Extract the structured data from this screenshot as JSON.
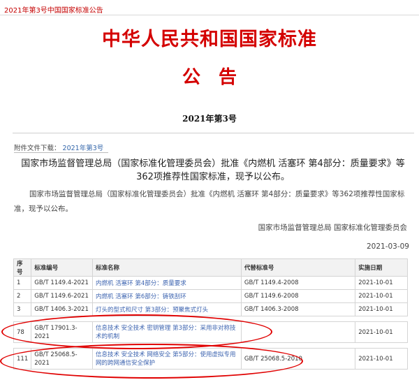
{
  "topbar": {
    "breadcrumb": "2021年第3号中国国家标准公告"
  },
  "header": {
    "title": "中华人民共和国国家标准",
    "subtitle": "公告",
    "issue": "2021年第3号"
  },
  "attachment": {
    "label": "附件文件下载：",
    "link": "2021年第3号"
  },
  "notice": {
    "headline": "国家市场监督管理总局（国家标准化管理委员会）批准《内燃机 活塞环 第4部分：质量要求》等362项推荐性国家标准，现予以公布。",
    "body": "国家市场监督管理总局（国家标准化管理委员会）批准《内燃机 活塞环 第4部分：质量要求》等362项推荐性国家标准，现予以公布。",
    "signer": "国家市场监督管理总局 国家标准化管理委员会",
    "date": "2021-03-09"
  },
  "table": {
    "headers": {
      "no": "序号",
      "code": "标准编号",
      "name": "标准名称",
      "replaced": "代替标准号",
      "date": "实施日期"
    },
    "rows": [
      {
        "no": "1",
        "code": "GB/T 1149.4-2021",
        "name": "内燃机 活塞环 第4部分：质量要求",
        "replaced": "GB/T 1149.4-2008",
        "date": "2021-10-01"
      },
      {
        "no": "2",
        "code": "GB/T 1149.6-2021",
        "name": "内燃机 活塞环 第6部分：铸铁刮环",
        "replaced": "GB/T 1149.6-2008",
        "date": "2021-10-01"
      },
      {
        "no": "3",
        "code": "GB/T 1406.3-2021",
        "name": "灯头的型式和尺寸 第3部分：预聚焦式灯头",
        "replaced": "GB/T 1406.3-2008",
        "date": "2021-10-01"
      },
      {
        "no": "78",
        "code": "GB/T 17901.3-2021",
        "name": "信息技术 安全技术 密钥管理 第3部分：采用非对称技术的机制",
        "replaced": "",
        "date": "2021-10-01"
      },
      {
        "no": "111",
        "code": "GB/T 25068.5-2021",
        "name": "信息技术 安全技术 网络安全 第5部分：使用虚拟专用网的跨网通信安全保护",
        "replaced": "GB/T 25068.5-2010",
        "date": "2021-10-01"
      }
    ]
  },
  "colors": {
    "accent_red": "#d40000",
    "link_blue": "#3d64b0",
    "annotation_red": "#e00000"
  }
}
